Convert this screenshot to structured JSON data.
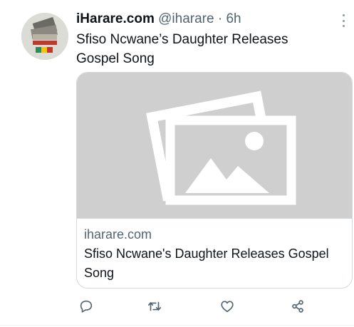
{
  "tweet": {
    "display_name": "iHarare.com",
    "handle": "@iharare",
    "separator": "·",
    "time": "6h",
    "text": "Sfiso Ncwane’s Daughter Releases Gospel Song"
  },
  "card": {
    "domain": "iharare.com",
    "title": "Sfiso Ncwane's Daughter Releases Gospel Song",
    "media_icon": "image-placeholder-icon"
  },
  "actions": [
    {
      "icon": "reply-icon"
    },
    {
      "icon": "retweet-icon"
    },
    {
      "icon": "like-icon"
    },
    {
      "icon": "share-icon"
    }
  ],
  "colors": {
    "text": "#0f1419",
    "secondary": "#536471",
    "border": "#cfd9de",
    "media_bg": "#cfcfcf",
    "icon": "#536471"
  }
}
